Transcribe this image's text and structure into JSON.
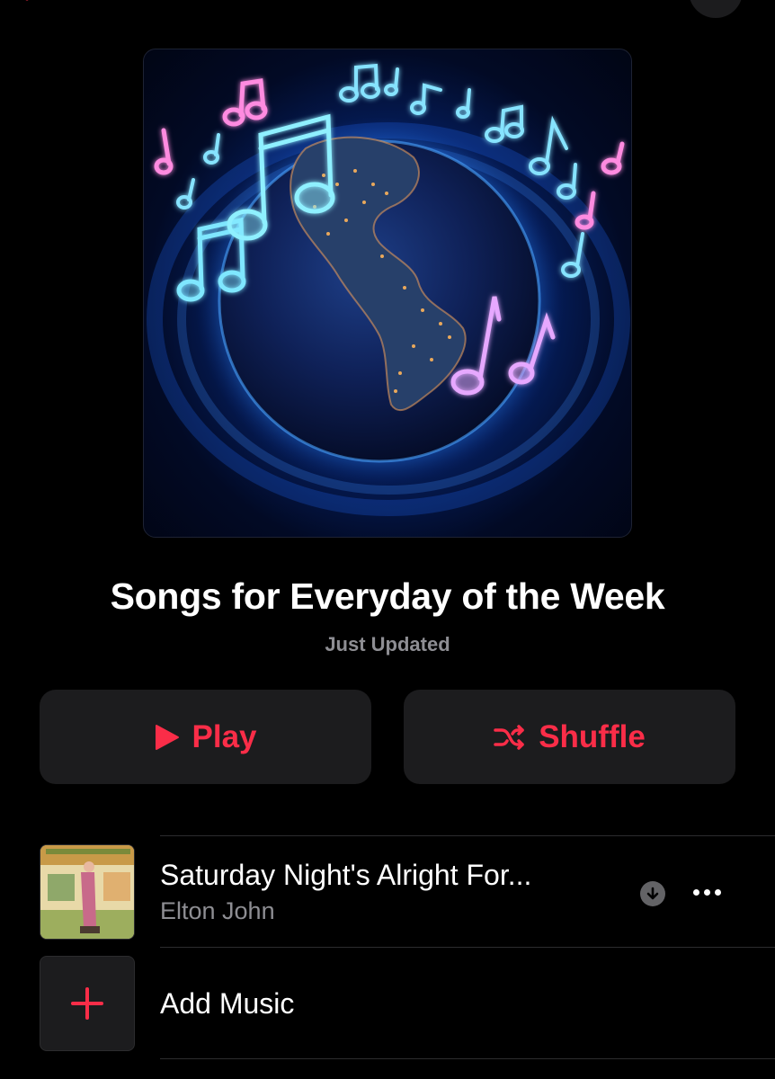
{
  "playlist": {
    "title": "Songs for Everyday of the Week",
    "subtitle": "Just Updated"
  },
  "actions": {
    "play_label": "Play",
    "shuffle_label": "Shuffle"
  },
  "tracks": [
    {
      "title": "Saturday Night's Alright For...",
      "artist": "Elton John",
      "icons": [
        "download-icon",
        "more-icon"
      ]
    }
  ],
  "add_music": {
    "label": "Add Music",
    "icon": "plus-icon"
  },
  "colors": {
    "accent": "#fa2d48",
    "background": "#000000",
    "button_bg": "#1c1c1e",
    "secondary_text": "#8e8e93"
  }
}
